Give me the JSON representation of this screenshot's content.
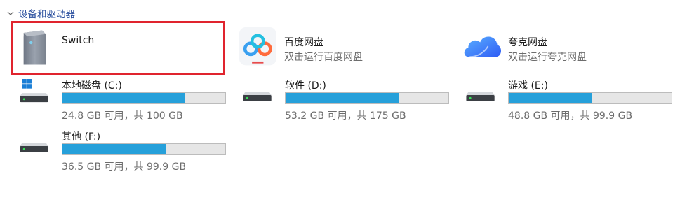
{
  "group": {
    "title": "设备和驱动器"
  },
  "devices": [
    {
      "name": "Switch",
      "subtitle": "",
      "icon": "switch-device-icon"
    },
    {
      "name": "百度网盘",
      "subtitle": "双击运行百度网盘",
      "icon": "baidu-netdisk-icon"
    },
    {
      "name": "夸克网盘",
      "subtitle": "双击运行夸克网盘",
      "icon": "quark-netdisk-icon"
    }
  ],
  "drives": [
    {
      "name": "本地磁盘 (C:)",
      "space": "24.8 GB 可用，共 100 GB",
      "used_fraction": 0.752,
      "icon": "system-drive-icon"
    },
    {
      "name": "软件 (D:)",
      "space": "53.2 GB 可用，共 175 GB",
      "used_fraction": 0.696,
      "icon": "hard-drive-icon"
    },
    {
      "name": "游戏 (E:)",
      "space": "48.8 GB 可用，共 99.9 GB",
      "used_fraction": 0.512,
      "icon": "hard-drive-icon"
    },
    {
      "name": "其他 (F:)",
      "space": "36.5 GB 可用，共 99.9 GB",
      "used_fraction": 0.635,
      "icon": "hard-drive-icon"
    }
  ],
  "colors": {
    "bar_fill": "#26a0da",
    "highlight": "#e0242e",
    "group_header": "#2a4f9e"
  }
}
